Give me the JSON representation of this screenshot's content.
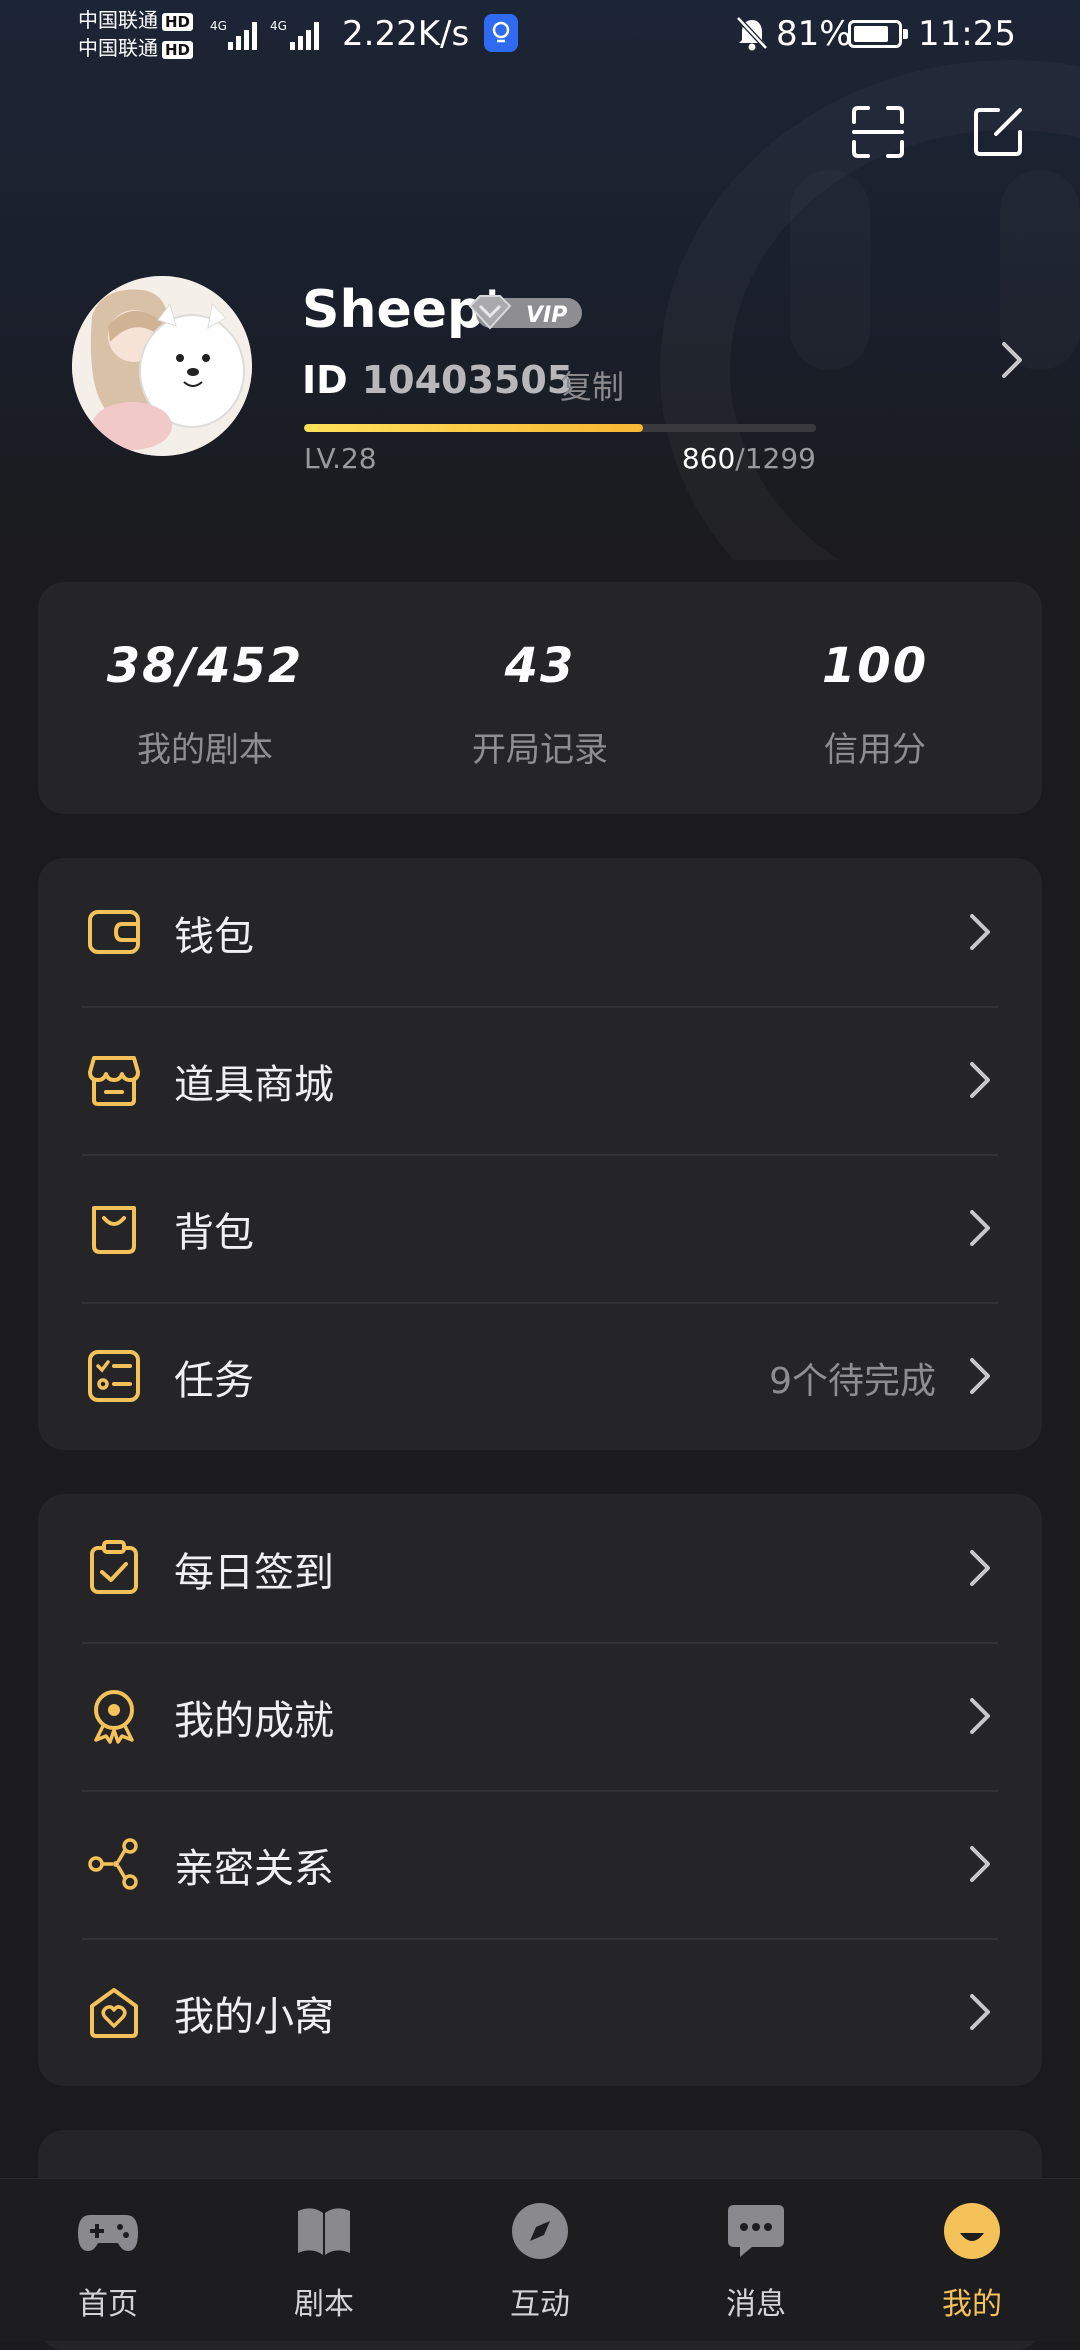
{
  "status_bar": {
    "carrier_1": "中国联通",
    "carrier_2": "中国联通",
    "hd": "HD",
    "net_1": "4G",
    "net_2": "4G",
    "speed": "2.22K/s",
    "battery": "81%",
    "battery_level": 0.81,
    "time": "11:25"
  },
  "header": {
    "scan_icon": "scan-icon",
    "edit_icon": "edit-icon"
  },
  "profile": {
    "username": "Sheep'",
    "vip_badge": "VIP",
    "id_label": "ID",
    "id_value": "10403505",
    "copy_label": "复制",
    "level": "LV.28",
    "xp_current": "860",
    "xp_total": "/1299",
    "xp_progress": 0.662
  },
  "stats": [
    {
      "value": "38/452",
      "label": "我的剧本"
    },
    {
      "value": "43",
      "label": "开局记录"
    },
    {
      "value": "100",
      "label": "信用分"
    }
  ],
  "menu_group_1": [
    {
      "label": "钱包",
      "icon": "wallet-icon",
      "extra": ""
    },
    {
      "label": "道具商城",
      "icon": "shop-icon",
      "extra": ""
    },
    {
      "label": "背包",
      "icon": "bag-icon",
      "extra": ""
    },
    {
      "label": "任务",
      "icon": "task-list-icon",
      "extra": "9个待完成"
    }
  ],
  "menu_group_2": [
    {
      "label": "每日签到",
      "icon": "checkin-icon"
    },
    {
      "label": "我的成就",
      "icon": "medal-icon"
    },
    {
      "label": "亲密关系",
      "icon": "share-nodes-icon"
    },
    {
      "label": "我的小窝",
      "icon": "home-heart-icon"
    }
  ],
  "tabs": [
    {
      "label": "首页",
      "icon": "gamepad-icon",
      "active": false
    },
    {
      "label": "剧本",
      "icon": "book-icon",
      "active": false
    },
    {
      "label": "互动",
      "icon": "compass-icon",
      "active": false
    },
    {
      "label": "消息",
      "icon": "chat-icon",
      "active": false
    },
    {
      "label": "我的",
      "icon": "smiley-icon",
      "active": true
    }
  ],
  "colors": {
    "accent": "#f5c25a",
    "background": "#1b1b1d",
    "card": "#252527",
    "vip": "#8d8d92"
  }
}
